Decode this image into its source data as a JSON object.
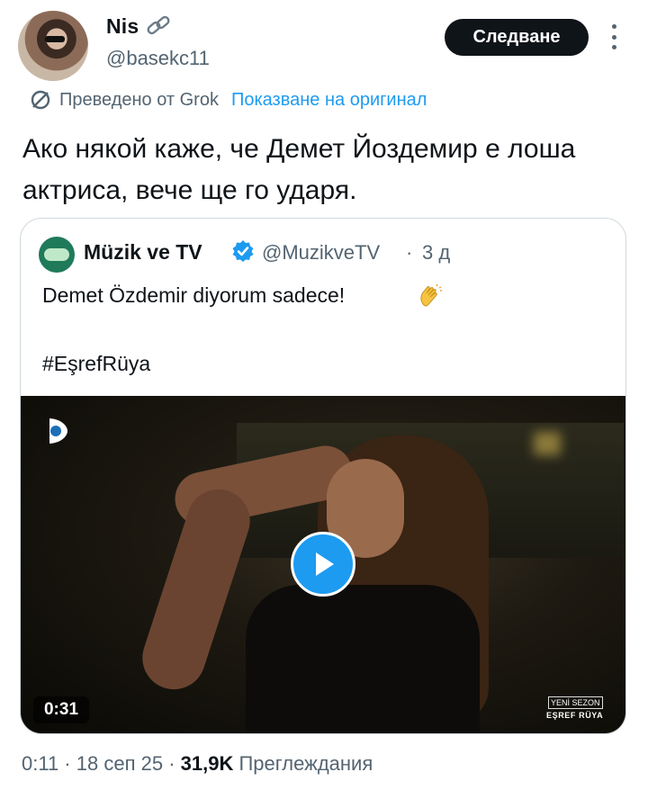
{
  "tweet": {
    "display_name": "Nis",
    "handle": "@basekc11",
    "follow_label": "Следване",
    "translated_by": "Преведено от Grok",
    "show_original": "Показване на оригинал",
    "text": "Ако някой каже, че Демет Йоздемир е лоша актриса, вече ще го ударя."
  },
  "quote": {
    "display_name": "Müzik ve TV",
    "handle": "@MuzikveTV",
    "separator": "·",
    "time": "3 д",
    "text_line1": "Demet Özdemir diyorum sadece!",
    "text_line2": "#EşrefRüya",
    "video": {
      "duration": "0:31",
      "season_tag": "YENİ SEZON",
      "show_tag": "EŞREF RÜYA"
    }
  },
  "meta": {
    "time": "0:11",
    "sep": " · ",
    "date": "18 сеп 25",
    "sep2": " · ",
    "views_count": "31,9K",
    "views_label": " Преглеждания"
  },
  "icons": {
    "link": "link-icon",
    "more": "more-icon",
    "translate": "translate-icon",
    "verified": "verified-badge-icon",
    "clap": "clapping-hands-icon",
    "play": "play-icon"
  },
  "colors": {
    "accent": "#1d9bf0",
    "text": "#0f1419",
    "secondary": "#536471",
    "button_bg": "#0f1419"
  }
}
